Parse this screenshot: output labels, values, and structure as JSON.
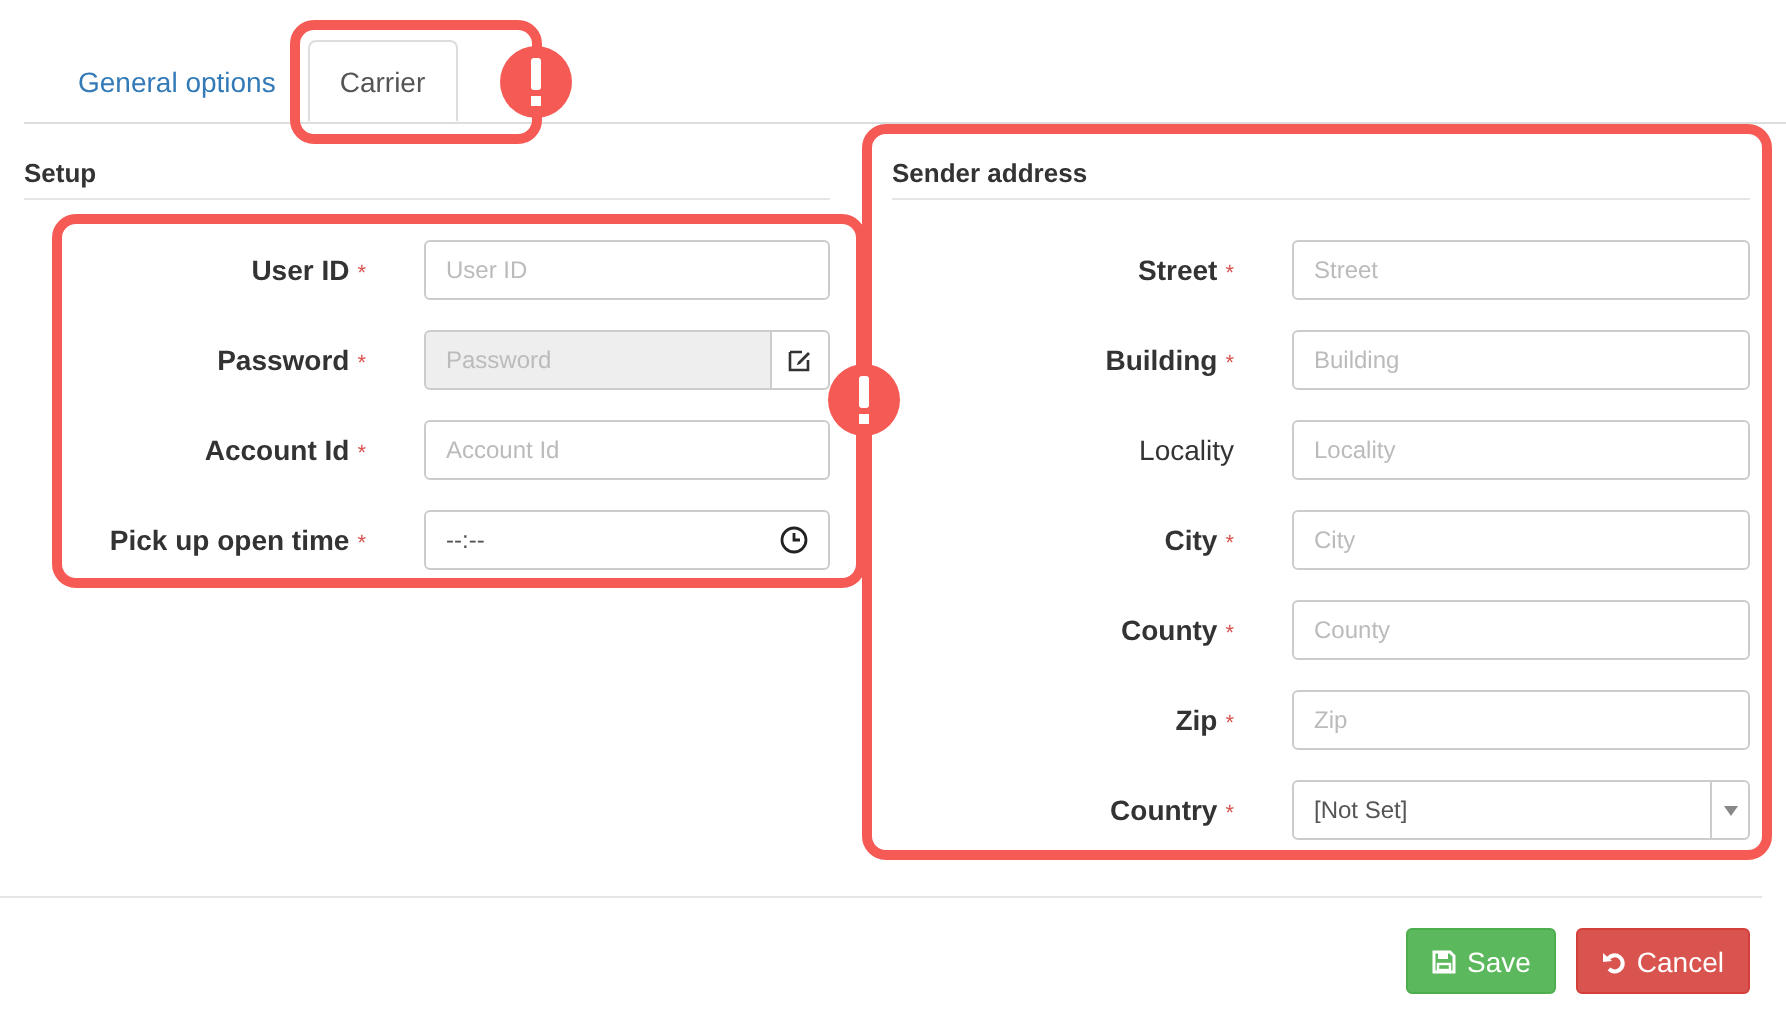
{
  "tabs": [
    {
      "label": "General options",
      "selected": false
    },
    {
      "label": "Carrier",
      "selected": true
    }
  ],
  "setup": {
    "title": "Setup",
    "fields": [
      {
        "label": "User ID",
        "mark": "*",
        "kind": "text",
        "placeholder": "User ID"
      },
      {
        "label": "Password",
        "mark": "*",
        "kind": "password",
        "placeholder": "Password",
        "disabled": true
      },
      {
        "label": "Account Id",
        "mark": "*",
        "kind": "text",
        "placeholder": "Account Id"
      },
      {
        "label": "Pick up open time",
        "mark": "*",
        "kind": "time",
        "value": "--:--"
      }
    ]
  },
  "sender": {
    "title": "Sender address",
    "fields": [
      {
        "label": "Street",
        "mark": "*",
        "kind": "text",
        "placeholder": "Street"
      },
      {
        "label": "Building",
        "mark": "*",
        "kind": "text",
        "placeholder": "Building"
      },
      {
        "label": "Locality",
        "kind": "text",
        "placeholder": "Locality"
      },
      {
        "label": "City",
        "mark": "*",
        "kind": "text",
        "placeholder": "City"
      },
      {
        "label": "County",
        "mark": "*",
        "kind": "text",
        "placeholder": "County"
      },
      {
        "label": "Zip",
        "mark": "*",
        "kind": "text",
        "placeholder": "Zip"
      },
      {
        "label": "Country",
        "mark": "*",
        "kind": "select",
        "value": "[Not Set]"
      }
    ]
  },
  "buttons": [
    {
      "label": "Save",
      "kind": "save"
    },
    {
      "label": "Cancel",
      "kind": "cancel"
    }
  ]
}
